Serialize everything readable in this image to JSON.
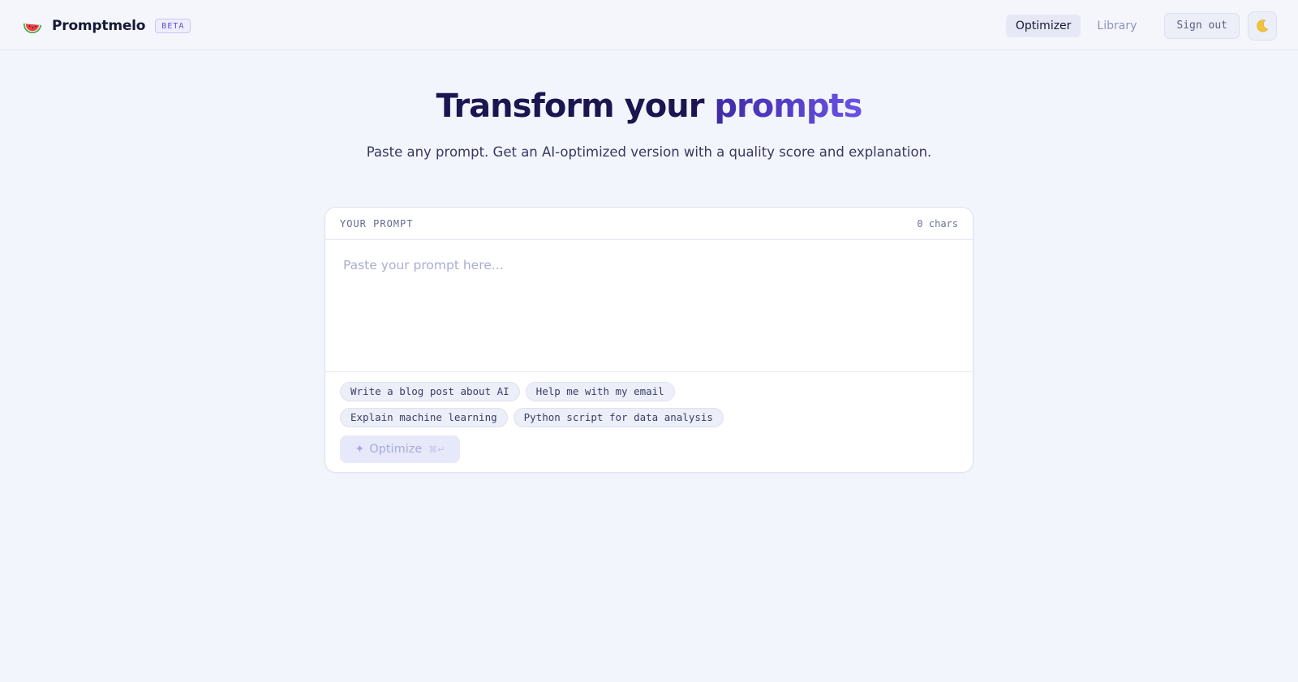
{
  "header": {
    "brand_name": "Promptmelo",
    "brand_icon": "watermelon-icon",
    "badge": "BETA",
    "nav": [
      {
        "label": "Optimizer",
        "active": true
      },
      {
        "label": "Library",
        "active": false
      }
    ],
    "sign_out_label": "Sign out",
    "theme_icon": "moon-icon"
  },
  "hero": {
    "title_main": "Transform your",
    "title_accent": "prompts",
    "subtitle": "Paste any prompt. Get an AI-optimized version with a quality score and explanation."
  },
  "prompt_card": {
    "label": "YOUR PROMPT",
    "char_count": "0 chars",
    "value": "",
    "placeholder": "Paste your prompt here...",
    "suggestions": [
      "Write a blog post about AI",
      "Help me with my email",
      "Explain machine learning",
      "Python script for data analysis"
    ],
    "optimize_label": "Optimize",
    "optimize_icon": "sparkle-icon",
    "optimize_shortcut": "⌘↵"
  },
  "colors": {
    "accent": "#5b45e0",
    "title": "#1a1650",
    "background": "#f3f5fc"
  }
}
